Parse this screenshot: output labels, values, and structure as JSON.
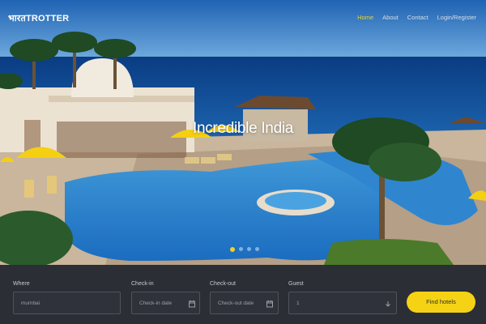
{
  "brand": {
    "hindi": "भारत",
    "latin": "TROTTER"
  },
  "nav": [
    {
      "label": "Home",
      "active": true
    },
    {
      "label": "About",
      "active": false
    },
    {
      "label": "Contact",
      "active": false
    },
    {
      "label": "Login/Register",
      "active": false
    }
  ],
  "hero": {
    "title": "Incredible India",
    "slides_total": 4,
    "active_slide": 1
  },
  "search": {
    "where": {
      "label": "Where",
      "value": "mumbai"
    },
    "checkin": {
      "label": "Check-in",
      "placeholder": "Check-in date",
      "icon": "calendar-icon"
    },
    "checkout": {
      "label": "Check-out",
      "placeholder": "Check-out date",
      "icon": "calendar-icon"
    },
    "guest": {
      "label": "Guest",
      "value": "1",
      "icon": "chevron-down-icon"
    },
    "button": "Find hotels"
  },
  "colors": {
    "accent": "#f5d314",
    "panel": "#2b2e35",
    "field_border": "#4f535c"
  }
}
